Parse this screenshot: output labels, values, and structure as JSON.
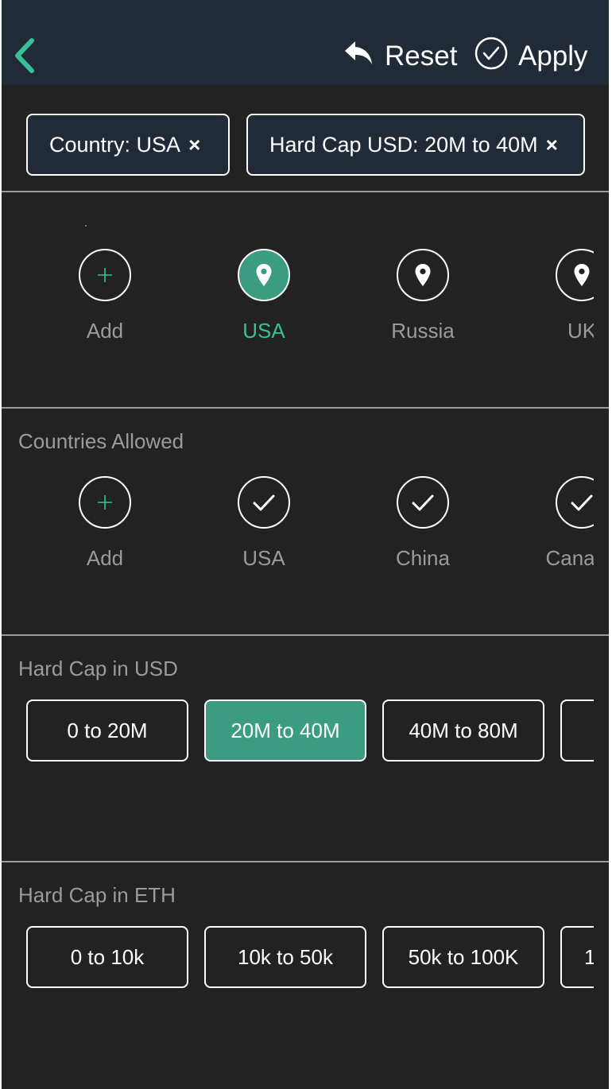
{
  "header": {
    "reset_label": "Reset",
    "apply_label": "Apply",
    "accent_color": "#36c296"
  },
  "active_filters": [
    {
      "label": "Country: USA"
    },
    {
      "label": "Hard Cap USD: 20M to 40M"
    }
  ],
  "chip_remove_glyph": "×",
  "country_section": {
    "title": "",
    "items": [
      {
        "label": "Add",
        "icon": "plus-icon"
      },
      {
        "label": "USA",
        "icon": "location-pin-icon",
        "selected": true
      },
      {
        "label": "Russia",
        "icon": "location-pin-icon"
      },
      {
        "label": "UK",
        "icon": "location-pin-icon"
      }
    ]
  },
  "countries_allowed": {
    "title": "Countries Allowed",
    "items": [
      {
        "label": "Add",
        "icon": "plus-icon"
      },
      {
        "label": "USA",
        "icon": "check-icon"
      },
      {
        "label": "China",
        "icon": "check-icon"
      },
      {
        "label": "Canada",
        "icon": "check-icon"
      }
    ]
  },
  "hard_cap_usd": {
    "title": "Hard Cap in USD",
    "options": [
      "0 to 20M",
      "20M to 40M",
      "40M to 80M",
      ""
    ],
    "selected": "20M to 40M"
  },
  "hard_cap_eth": {
    "title": "Hard Cap in ETH",
    "options": [
      "0 to 10k",
      "10k to 50k",
      "50k to 100K",
      "1"
    ]
  }
}
